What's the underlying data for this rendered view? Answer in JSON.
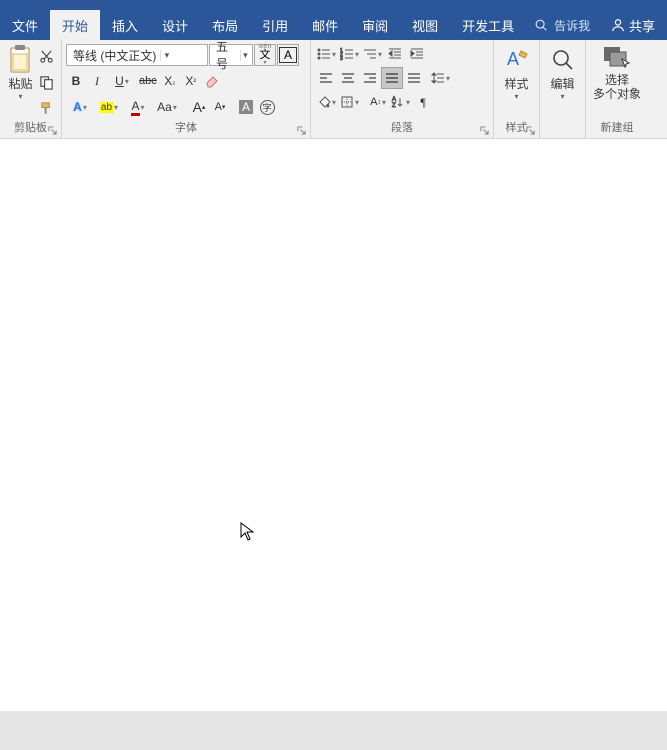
{
  "tabs": {
    "file": "文件",
    "home": "开始",
    "insert": "插入",
    "design": "设计",
    "layout": "布局",
    "references": "引用",
    "mail": "邮件",
    "review": "审阅",
    "view": "视图",
    "dev": "开发工具",
    "tell_placeholder": "告诉我",
    "share": "共享"
  },
  "clipboard": {
    "paste": "粘贴",
    "group": "剪贴板"
  },
  "font": {
    "name": "等线 (中文正文)",
    "size": "五号",
    "ruby": "wén",
    "charborder": "A",
    "bold": "B",
    "italic": "I",
    "underline": "U",
    "strike": "abc",
    "sub": "X",
    "subSmall": "₂",
    "sup": "X",
    "supSmall": "²",
    "textfx": "A",
    "hilite": "ab",
    "fcolor": "A",
    "phonetic": "A",
    "changecase": "Aa",
    "grow": "A",
    "shrink": "A",
    "charshade": "A",
    "circled": "字",
    "clear": "♦",
    "group": "字体"
  },
  "para": {
    "group": "段落"
  },
  "styles": {
    "label": "样式",
    "group": "样式"
  },
  "editing": {
    "label": "编辑"
  },
  "newgroup": {
    "select_multi": "选择\n多个对象",
    "group": "新建组"
  }
}
